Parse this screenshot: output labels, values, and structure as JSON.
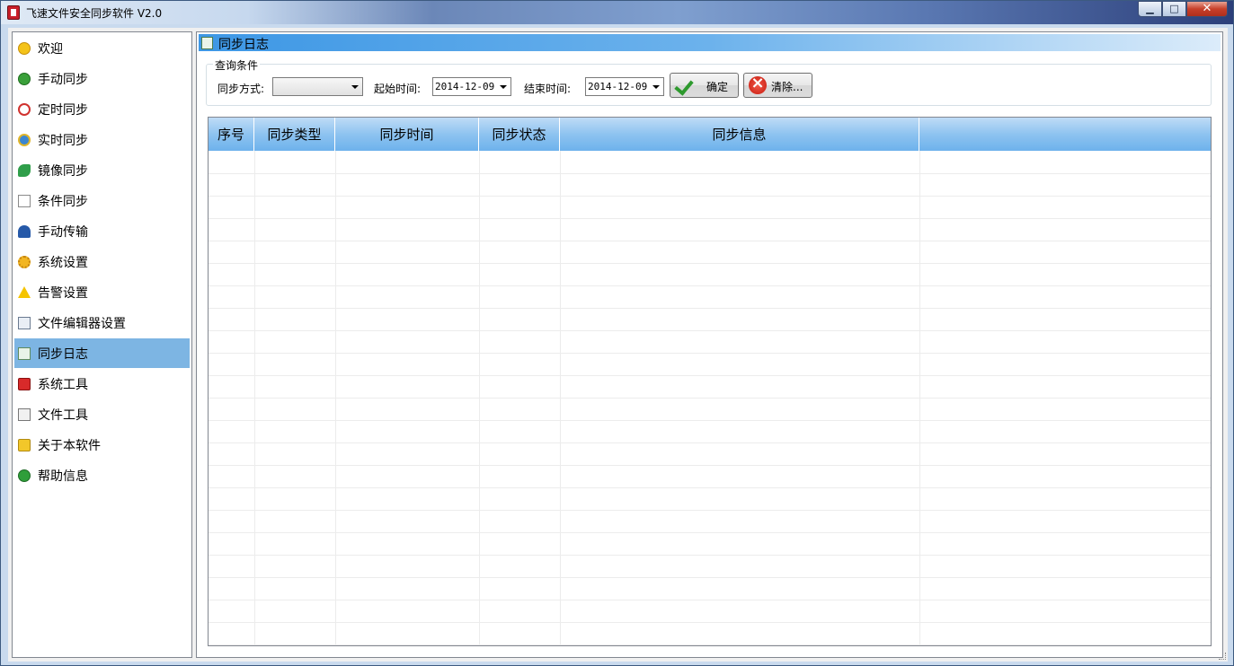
{
  "window": {
    "title": "飞速文件安全同步软件 V2.0",
    "controls": {
      "minimize": "▁",
      "maximize": "□",
      "close": "✕"
    }
  },
  "sidebar": {
    "items": [
      {
        "label": "欢迎",
        "icon": "smile-icon"
      },
      {
        "label": "手动同步",
        "icon": "sync-icon"
      },
      {
        "label": "定时同步",
        "icon": "clock-icon"
      },
      {
        "label": "实时同步",
        "icon": "realtime-clock-icon"
      },
      {
        "label": "镜像同步",
        "icon": "mirror-icon"
      },
      {
        "label": "条件同步",
        "icon": "condition-doc-icon"
      },
      {
        "label": "手动传输",
        "icon": "user-icon"
      },
      {
        "label": "系统设置",
        "icon": "gear-icon"
      },
      {
        "label": "告警设置",
        "icon": "warning-icon"
      },
      {
        "label": "文件编辑器设置",
        "icon": "editor-icon"
      },
      {
        "label": "同步日志",
        "icon": "log-icon",
        "active": true
      },
      {
        "label": "系统工具",
        "icon": "toolbox-icon"
      },
      {
        "label": "文件工具",
        "icon": "file-tool-icon"
      },
      {
        "label": "关于本软件",
        "icon": "about-icon"
      },
      {
        "label": "帮助信息",
        "icon": "help-icon"
      }
    ]
  },
  "panel": {
    "title": "同步日志",
    "query": {
      "group_title": "查询条件",
      "mode_label": "同步方式:",
      "mode_value": "",
      "start_label": "起始时间:",
      "start_value": "2014-12-09",
      "end_label": "结束时间:",
      "end_value": "2014-12-09",
      "confirm_label": "确定",
      "clear_label": "清除..."
    },
    "table": {
      "columns": [
        "序号",
        "同步类型",
        "同步时间",
        "同步状态",
        "同步信息",
        ""
      ],
      "rows": []
    }
  },
  "colors": {
    "active_item": "#7db5e3",
    "header_gradient_start": "#3d97e5",
    "table_header": "#8ec3f0"
  }
}
